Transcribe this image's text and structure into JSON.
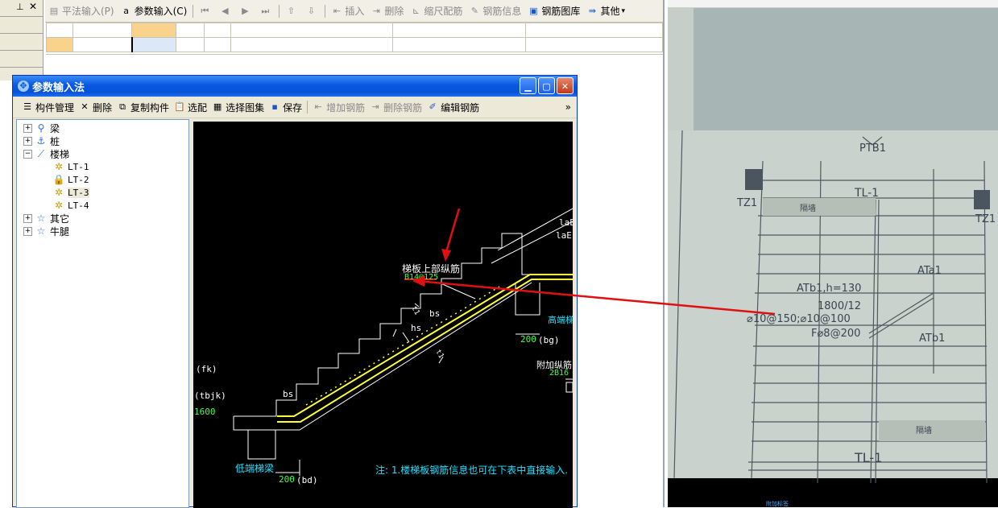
{
  "main_toolbar": {
    "items": [
      {
        "label": "平法输入(P)",
        "enabled": false
      },
      {
        "label": "参数输入(C)",
        "enabled": true
      },
      {
        "label": "插入",
        "enabled": false
      },
      {
        "label": "删除",
        "enabled": false
      },
      {
        "label": "缩尺配筋",
        "enabled": false
      },
      {
        "label": "钢筋信息",
        "enabled": false
      },
      {
        "label": "钢筋图库",
        "enabled": true
      },
      {
        "label": "其他",
        "enabled": true
      }
    ]
  },
  "dialog": {
    "title": "参数输入法",
    "toolbar": {
      "component_manage": "构件管理",
      "delete": "删除",
      "copy_component": "复制构件",
      "select_match": "选配",
      "select_atlas": "选择图集",
      "save": "保存",
      "add_rebar": "增加钢筋",
      "delete_rebar": "删除钢筋",
      "edit_rebar": "编辑钢筋",
      "more": "»"
    },
    "tree": [
      {
        "label": "梁",
        "expander": "+"
      },
      {
        "label": "桩",
        "expander": "+"
      },
      {
        "label": "楼梯",
        "expander": "−"
      },
      {
        "label": "LT-1"
      },
      {
        "label": "LT-2"
      },
      {
        "label": "LT-3",
        "selected": true
      },
      {
        "label": "LT-4"
      },
      {
        "label": "其它",
        "expander": "+"
      },
      {
        "label": "牛腿",
        "expander": "+"
      }
    ],
    "drawing": {
      "top_rebar_label": "梯板上部纵筋",
      "top_rebar_value": "B14@125",
      "laE1": "laE",
      "laE2": "laE",
      "bs1": "bs",
      "hs": "hs",
      "bs2": "bs",
      "t1": "t1",
      "t2": "t1",
      "high_beam": "高端梯",
      "dim200_top": "200",
      "bg": "(bg)",
      "extra_rebar": "附加纵筋",
      "extra_rebar_value": "2B16",
      "fk": "(fk)",
      "tbjk": "(tbjk)",
      "v1600": "1600",
      "low_beam": "低端梯梁",
      "dim200_bottom": "200",
      "bd": "(bd)",
      "note": "注: 1.楼梯板钢筋信息也可在下表中直接输入."
    }
  },
  "photo": {
    "labels": {
      "ptb1": "PTB1",
      "tz1_left": "TZ1",
      "tz1_right": "TZ1",
      "tl1_top": "TL-1",
      "tl1_bottom": "TL-1",
      "atb1_h": "ATb1,h=130",
      "dim": "1800/12",
      "rebar1": "⌀10@150;⌀10@100",
      "rebar2": "F⌀8@200",
      "ata1": "ATa1",
      "atb1": "ATb1",
      "ptb_right": "PTB1",
      "wall1": "隔墙",
      "wall2": "隔墙",
      "bottom_caption": "附加标签"
    }
  },
  "colors": {
    "titlebar": "#0a58e0",
    "rebar": "#ffff33",
    "annotation_arrow": "#e01010"
  }
}
